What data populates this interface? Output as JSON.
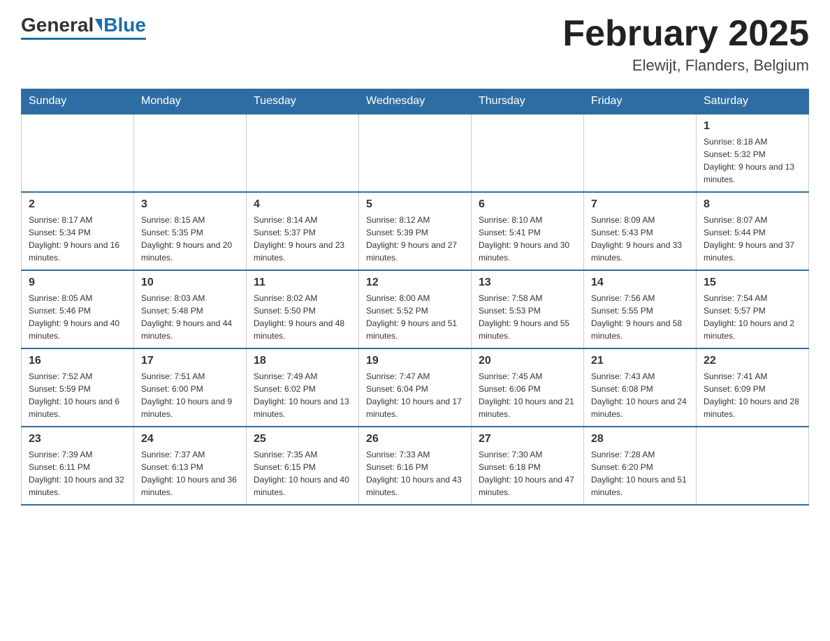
{
  "header": {
    "logo_general": "General",
    "logo_blue": "Blue",
    "month_title": "February 2025",
    "location": "Elewijt, Flanders, Belgium"
  },
  "days_of_week": [
    "Sunday",
    "Monday",
    "Tuesday",
    "Wednesday",
    "Thursday",
    "Friday",
    "Saturday"
  ],
  "weeks": [
    [
      {
        "day": "",
        "info": ""
      },
      {
        "day": "",
        "info": ""
      },
      {
        "day": "",
        "info": ""
      },
      {
        "day": "",
        "info": ""
      },
      {
        "day": "",
        "info": ""
      },
      {
        "day": "",
        "info": ""
      },
      {
        "day": "1",
        "info": "Sunrise: 8:18 AM\nSunset: 5:32 PM\nDaylight: 9 hours and 13 minutes."
      }
    ],
    [
      {
        "day": "2",
        "info": "Sunrise: 8:17 AM\nSunset: 5:34 PM\nDaylight: 9 hours and 16 minutes."
      },
      {
        "day": "3",
        "info": "Sunrise: 8:15 AM\nSunset: 5:35 PM\nDaylight: 9 hours and 20 minutes."
      },
      {
        "day": "4",
        "info": "Sunrise: 8:14 AM\nSunset: 5:37 PM\nDaylight: 9 hours and 23 minutes."
      },
      {
        "day": "5",
        "info": "Sunrise: 8:12 AM\nSunset: 5:39 PM\nDaylight: 9 hours and 27 minutes."
      },
      {
        "day": "6",
        "info": "Sunrise: 8:10 AM\nSunset: 5:41 PM\nDaylight: 9 hours and 30 minutes."
      },
      {
        "day": "7",
        "info": "Sunrise: 8:09 AM\nSunset: 5:43 PM\nDaylight: 9 hours and 33 minutes."
      },
      {
        "day": "8",
        "info": "Sunrise: 8:07 AM\nSunset: 5:44 PM\nDaylight: 9 hours and 37 minutes."
      }
    ],
    [
      {
        "day": "9",
        "info": "Sunrise: 8:05 AM\nSunset: 5:46 PM\nDaylight: 9 hours and 40 minutes."
      },
      {
        "day": "10",
        "info": "Sunrise: 8:03 AM\nSunset: 5:48 PM\nDaylight: 9 hours and 44 minutes."
      },
      {
        "day": "11",
        "info": "Sunrise: 8:02 AM\nSunset: 5:50 PM\nDaylight: 9 hours and 48 minutes."
      },
      {
        "day": "12",
        "info": "Sunrise: 8:00 AM\nSunset: 5:52 PM\nDaylight: 9 hours and 51 minutes."
      },
      {
        "day": "13",
        "info": "Sunrise: 7:58 AM\nSunset: 5:53 PM\nDaylight: 9 hours and 55 minutes."
      },
      {
        "day": "14",
        "info": "Sunrise: 7:56 AM\nSunset: 5:55 PM\nDaylight: 9 hours and 58 minutes."
      },
      {
        "day": "15",
        "info": "Sunrise: 7:54 AM\nSunset: 5:57 PM\nDaylight: 10 hours and 2 minutes."
      }
    ],
    [
      {
        "day": "16",
        "info": "Sunrise: 7:52 AM\nSunset: 5:59 PM\nDaylight: 10 hours and 6 minutes."
      },
      {
        "day": "17",
        "info": "Sunrise: 7:51 AM\nSunset: 6:00 PM\nDaylight: 10 hours and 9 minutes."
      },
      {
        "day": "18",
        "info": "Sunrise: 7:49 AM\nSunset: 6:02 PM\nDaylight: 10 hours and 13 minutes."
      },
      {
        "day": "19",
        "info": "Sunrise: 7:47 AM\nSunset: 6:04 PM\nDaylight: 10 hours and 17 minutes."
      },
      {
        "day": "20",
        "info": "Sunrise: 7:45 AM\nSunset: 6:06 PM\nDaylight: 10 hours and 21 minutes."
      },
      {
        "day": "21",
        "info": "Sunrise: 7:43 AM\nSunset: 6:08 PM\nDaylight: 10 hours and 24 minutes."
      },
      {
        "day": "22",
        "info": "Sunrise: 7:41 AM\nSunset: 6:09 PM\nDaylight: 10 hours and 28 minutes."
      }
    ],
    [
      {
        "day": "23",
        "info": "Sunrise: 7:39 AM\nSunset: 6:11 PM\nDaylight: 10 hours and 32 minutes."
      },
      {
        "day": "24",
        "info": "Sunrise: 7:37 AM\nSunset: 6:13 PM\nDaylight: 10 hours and 36 minutes."
      },
      {
        "day": "25",
        "info": "Sunrise: 7:35 AM\nSunset: 6:15 PM\nDaylight: 10 hours and 40 minutes."
      },
      {
        "day": "26",
        "info": "Sunrise: 7:33 AM\nSunset: 6:16 PM\nDaylight: 10 hours and 43 minutes."
      },
      {
        "day": "27",
        "info": "Sunrise: 7:30 AM\nSunset: 6:18 PM\nDaylight: 10 hours and 47 minutes."
      },
      {
        "day": "28",
        "info": "Sunrise: 7:28 AM\nSunset: 6:20 PM\nDaylight: 10 hours and 51 minutes."
      },
      {
        "day": "",
        "info": ""
      }
    ]
  ]
}
